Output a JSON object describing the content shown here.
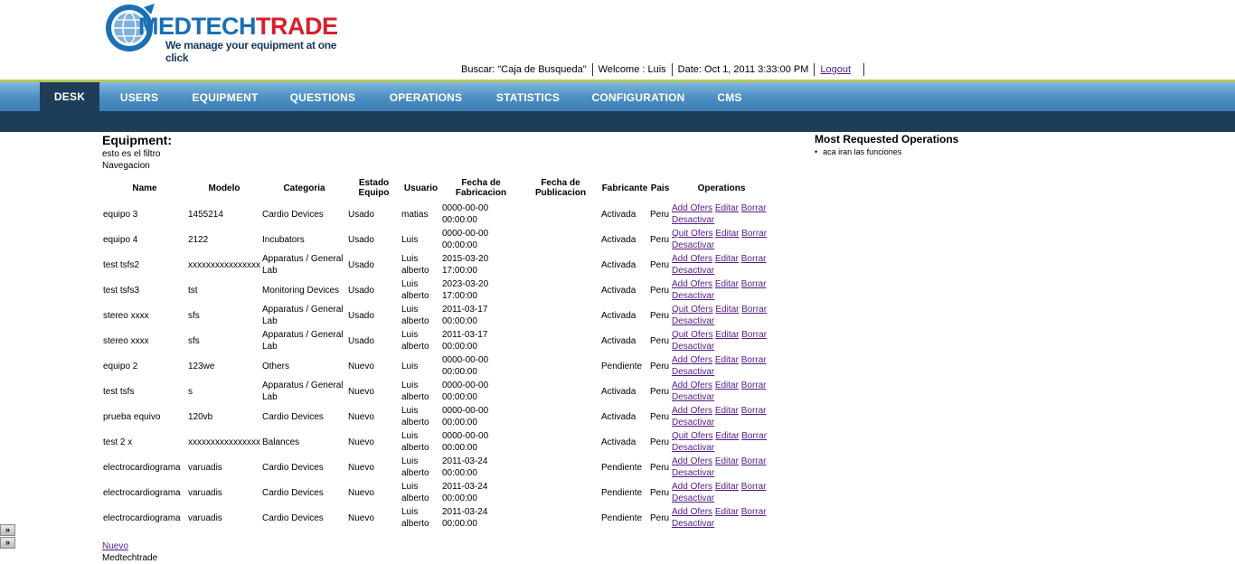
{
  "brand": {
    "name_part1": "MEDTECH",
    "name_part2": "TRADE",
    "tagline": "We manage your equipment at one click"
  },
  "userbar": {
    "search": "Buscar: \"Caja de Busqueda\"",
    "welcome": "Welcome : Luis",
    "date": "Date: Oct 1, 2011 3:33:00 PM",
    "logout": "Logout"
  },
  "nav": {
    "tabs": [
      {
        "label": "DESK",
        "active": true
      },
      {
        "label": "USERS"
      },
      {
        "label": "EQUIPMENT"
      },
      {
        "label": "QUESTIONS"
      },
      {
        "label": "OPERATIONS"
      },
      {
        "label": "STATISTICS"
      },
      {
        "label": "CONFIGURATION"
      },
      {
        "label": "CMS"
      }
    ]
  },
  "main": {
    "title": "Equipment:",
    "filter_text": "esto es el filtro",
    "nav_text": "Navegacion",
    "columns": [
      "Name",
      "Modelo",
      "Categoria",
      "Estado Equipo",
      "Usuario",
      "Fecha de Fabricacion",
      "Fecha de Publicacion",
      "Fabricante",
      "Pais",
      "Operations"
    ],
    "rows": [
      {
        "name": "equipo 3",
        "modelo": "1455214",
        "categoria": "Cardio Devices",
        "estado": "Usado",
        "usuario": "matias",
        "fecha_fab": "0000-00-00 00:00:00",
        "fecha_pub": "",
        "fabricante": "Activada",
        "pais": "Peru",
        "op1": "Add Ofers",
        "op2": "Editar",
        "op3": "Borrar",
        "op4": "Desactivar"
      },
      {
        "name": "equipo 4",
        "modelo": "2122",
        "categoria": "Incubators",
        "estado": "Usado",
        "usuario": "Luis",
        "fecha_fab": "0000-00-00 00:00:00",
        "fecha_pub": "",
        "fabricante": "Activada",
        "pais": "Peru",
        "op1": "Quit Ofers",
        "op2": "Editar",
        "op3": "Borrar",
        "op4": "Desactivar"
      },
      {
        "name": "test tsfs2",
        "modelo": "xxxxxxxxxxxxxxxx",
        "categoria": "Apparatus / General Lab",
        "estado": "Usado",
        "usuario": "Luis alberto",
        "fecha_fab": "2015-03-20 17:00:00",
        "fecha_pub": "",
        "fabricante": "Activada",
        "pais": "Peru",
        "op1": "Add Ofers",
        "op2": "Editar",
        "op3": "Borrar",
        "op4": "Desactivar"
      },
      {
        "name": "test tsfs3",
        "modelo": "tst",
        "categoria": "Monitoring Devices",
        "estado": "Usado",
        "usuario": "Luis alberto",
        "fecha_fab": "2023-03-20 17:00:00",
        "fecha_pub": "",
        "fabricante": "Activada",
        "pais": "Peru",
        "op1": "Add Ofers",
        "op2": "Editar",
        "op3": "Borrar",
        "op4": "Desactivar"
      },
      {
        "name": "stereo xxxx",
        "modelo": "sfs",
        "categoria": "Apparatus / General Lab",
        "estado": "Usado",
        "usuario": "Luis alberto",
        "fecha_fab": "2011-03-17 00:00:00",
        "fecha_pub": "",
        "fabricante": "Activada",
        "pais": "Peru",
        "op1": "Quit Ofers",
        "op2": "Editar",
        "op3": "Borrar",
        "op4": "Desactivar"
      },
      {
        "name": "stereo xxxx",
        "modelo": "sfs",
        "categoria": "Apparatus / General Lab",
        "estado": "Usado",
        "usuario": "Luis alberto",
        "fecha_fab": "2011-03-17 00:00:00",
        "fecha_pub": "",
        "fabricante": "Activada",
        "pais": "Peru",
        "op1": "Quit Ofers",
        "op2": "Editar",
        "op3": "Borrar",
        "op4": "Desactivar"
      },
      {
        "name": "equipo 2",
        "modelo": "123we",
        "categoria": "Others",
        "estado": "Nuevo",
        "usuario": "Luis",
        "fecha_fab": "0000-00-00 00:00:00",
        "fecha_pub": "",
        "fabricante": "Pendiente",
        "pais": "Peru",
        "op1": "Add Ofers",
        "op2": "Editar",
        "op3": "Borrar",
        "op4": "Desactivar"
      },
      {
        "name": "test tsfs",
        "modelo": "s",
        "categoria": "Apparatus / General Lab",
        "estado": "Nuevo",
        "usuario": "Luis alberto",
        "fecha_fab": "0000-00-00 00:00:00",
        "fecha_pub": "",
        "fabricante": "Activada",
        "pais": "Peru",
        "op1": "Add Ofers",
        "op2": "Editar",
        "op3": "Borrar",
        "op4": "Desactivar"
      },
      {
        "name": "prueba equivo",
        "modelo": "120vb",
        "categoria": "Cardio Devices",
        "estado": "Nuevo",
        "usuario": "Luis alberto",
        "fecha_fab": "0000-00-00 00:00:00",
        "fecha_pub": "",
        "fabricante": "Activada",
        "pais": "Peru",
        "op1": "Add Ofers",
        "op2": "Editar",
        "op3": "Borrar",
        "op4": "Desactivar"
      },
      {
        "name": "test 2 x",
        "modelo": "xxxxxxxxxxxxxxxx",
        "categoria": "Balances",
        "estado": "Nuevo",
        "usuario": "Luis alberto",
        "fecha_fab": "0000-00-00 00:00:00",
        "fecha_pub": "",
        "fabricante": "Activada",
        "pais": "Peru",
        "op1": "Quit Ofers",
        "op2": "Editar",
        "op3": "Borrar",
        "op4": "Desactivar"
      },
      {
        "name": "electrocardiograma",
        "modelo": "varuadis",
        "categoria": "Cardio Devices",
        "estado": "Nuevo",
        "usuario": "Luis alberto",
        "fecha_fab": "2011-03-24 00:00:00",
        "fecha_pub": "",
        "fabricante": "Pendiente",
        "pais": "Peru",
        "op1": "Add Ofers",
        "op2": "Editar",
        "op3": "Borrar",
        "op4": "Desactivar"
      },
      {
        "name": "electrocardiograma",
        "modelo": "varuadis",
        "categoria": "Cardio Devices",
        "estado": "Nuevo",
        "usuario": "Luis alberto",
        "fecha_fab": "2011-03-24 00:00:00",
        "fecha_pub": "",
        "fabricante": "Pendiente",
        "pais": "Peru",
        "op1": "Add Ofers",
        "op2": "Editar",
        "op3": "Borrar",
        "op4": "Desactivar"
      },
      {
        "name": "electrocardiograma",
        "modelo": "varuadis",
        "categoria": "Cardio Devices",
        "estado": "Nuevo",
        "usuario": "Luis alberto",
        "fecha_fab": "2011-03-24 00:00:00",
        "fecha_pub": "",
        "fabricante": "Pendiente",
        "pais": "Peru",
        "op1": "Add Ofers",
        "op2": "Editar",
        "op3": "Borrar",
        "op4": "Desactivar"
      }
    ]
  },
  "side": {
    "title": "Most Requested Operations",
    "items": [
      "aca iran las funciones"
    ]
  },
  "footer": {
    "new_link": "Nuevo",
    "brand_text": "Medtechtrade"
  },
  "collapse": {
    "btn1": "»",
    "btn2": "»"
  },
  "colors": {
    "nav_blue": "#4a8dc0",
    "nav_dark": "#1d3d58",
    "accent_green": "#b5c95a",
    "brand_blue": "#1a6fb5",
    "brand_red": "#d6212c"
  }
}
